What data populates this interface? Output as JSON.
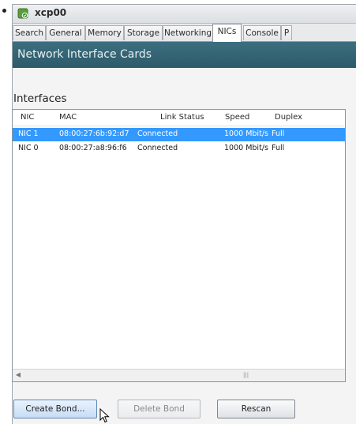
{
  "window": {
    "title": "xcp00",
    "icon": "server-icon"
  },
  "tabs": [
    {
      "label": "Search"
    },
    {
      "label": "General"
    },
    {
      "label": "Memory"
    },
    {
      "label": "Storage"
    },
    {
      "label": "Networking"
    },
    {
      "label": "NICs",
      "active": true
    },
    {
      "label": "Console"
    },
    {
      "label": "P"
    }
  ],
  "section": {
    "title": "Network Interface Cards"
  },
  "interfaces": {
    "label": "Interfaces",
    "columns": [
      "NIC",
      "MAC",
      "Link Status",
      "Speed",
      "Duplex"
    ],
    "rows": [
      {
        "nic": "NIC 1",
        "mac": "08:00:27:6b:92:d7",
        "status": "Connected",
        "speed": "1000 Mbit/s",
        "duplex": "Full",
        "selected": true
      },
      {
        "nic": "NIC 0",
        "mac": "08:00:27:a8:96:f6",
        "status": "Connected",
        "speed": "1000 Mbit/s",
        "duplex": "Full",
        "selected": false
      }
    ]
  },
  "buttons": {
    "create_bond": "Create Bond...",
    "delete_bond": "Delete Bond",
    "rescan": "Rescan"
  },
  "colors": {
    "header_bg": "#2f5f6f",
    "selection": "#3399ff"
  }
}
